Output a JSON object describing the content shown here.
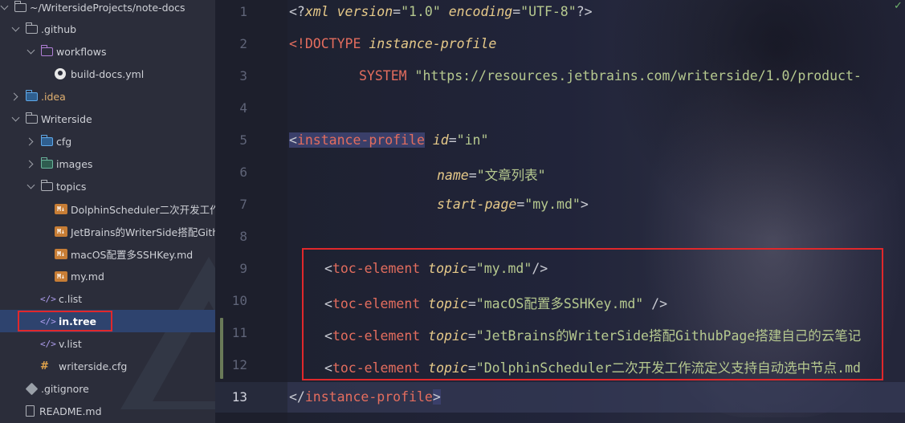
{
  "project_tree": {
    "items": [
      {
        "label": "~/WritersideProjects/note-docs",
        "icon": "folder-icon"
      },
      {
        "label": ".github",
        "icon": "folder-icon"
      },
      {
        "label": "workflows",
        "icon": "folder-icon"
      },
      {
        "label": "build-docs.yml",
        "icon": "github-icon"
      },
      {
        "label": ".idea",
        "icon": "folder-icon"
      },
      {
        "label": "Writerside",
        "icon": "folder-icon"
      },
      {
        "label": "cfg",
        "icon": "folder-icon"
      },
      {
        "label": "images",
        "icon": "folder-icon"
      },
      {
        "label": "topics",
        "icon": "folder-icon"
      },
      {
        "label": "DolphinScheduler二次开发工作流",
        "icon": "markdown-icon"
      },
      {
        "label": "JetBrains的WriterSide搭配Github",
        "icon": "markdown-icon"
      },
      {
        "label": "macOS配置多SSHKey.md",
        "icon": "markdown-icon"
      },
      {
        "label": "my.md",
        "icon": "markdown-icon"
      },
      {
        "label": "c.list",
        "icon": "xml-icon"
      },
      {
        "label": "in.tree",
        "icon": "xml-icon"
      },
      {
        "label": "v.list",
        "icon": "xml-icon"
      },
      {
        "label": "writerside.cfg",
        "icon": "config-icon"
      },
      {
        "label": ".gitignore",
        "icon": "git-icon"
      },
      {
        "label": "README.md",
        "icon": "file-icon"
      }
    ],
    "selected": "in.tree"
  },
  "editor": {
    "line_numbers": [
      "1",
      "2",
      "3",
      "4",
      "5",
      "6",
      "7",
      "8",
      "9",
      "10",
      "11",
      "12",
      "13"
    ],
    "current_line": "13",
    "colors": {
      "tag": "#e36d5e",
      "attribute": "#e6c989",
      "string": "#b6c98f",
      "highlight_box": "#e0282b"
    },
    "lines": {
      "l1": {
        "open": "<?",
        "tag": "xml",
        "a1": "version",
        "eq1": "=",
        "v1": "\"1.0\"",
        "a2": "encoding",
        "eq2": "=",
        "v2": "\"UTF-8\"",
        "close": "?>"
      },
      "l2": {
        "tag": "<!DOCTYPE",
        "name": "instance-profile"
      },
      "l3": {
        "kw": "SYSTEM",
        "url": "\"https://resources.jetbrains.com/writerside/1.0/product-"
      },
      "l5": {
        "lt": "<",
        "tag": "instance-profile",
        "attr": "id",
        "eq": "=",
        "val": "\"in\""
      },
      "l6": {
        "attr": "name",
        "eq": "=",
        "val": "\"文章列表\""
      },
      "l7": {
        "attr": "start-page",
        "eq": "=",
        "val": "\"my.md\"",
        "close": ">"
      },
      "l9": {
        "lt": "<",
        "tag": "toc-element",
        "attr": "topic",
        "eq": "=",
        "val": "\"my.md\"",
        "close": "/>"
      },
      "l10": {
        "lt": "<",
        "tag": "toc-element",
        "attr": "topic",
        "eq": "=",
        "val": "\"macOS配置多SSHKey.md\"",
        "close": " />"
      },
      "l11": {
        "lt": "<",
        "tag": "toc-element",
        "attr": "topic",
        "eq": "=",
        "val": "\"JetBrains的WriterSide搭配GithubPage搭建自己的云笔记"
      },
      "l12": {
        "lt": "<",
        "tag": "toc-element",
        "attr": "topic",
        "eq": "=",
        "val": "\"DolphinScheduler二次开发工作流定义支持自动选中节点.md"
      },
      "l13": {
        "lt": "</",
        "tag": "instance-profile",
        "close": ">"
      }
    }
  },
  "status": {
    "check_icon": "checkmark-icon",
    "check_glyph": "✓"
  }
}
